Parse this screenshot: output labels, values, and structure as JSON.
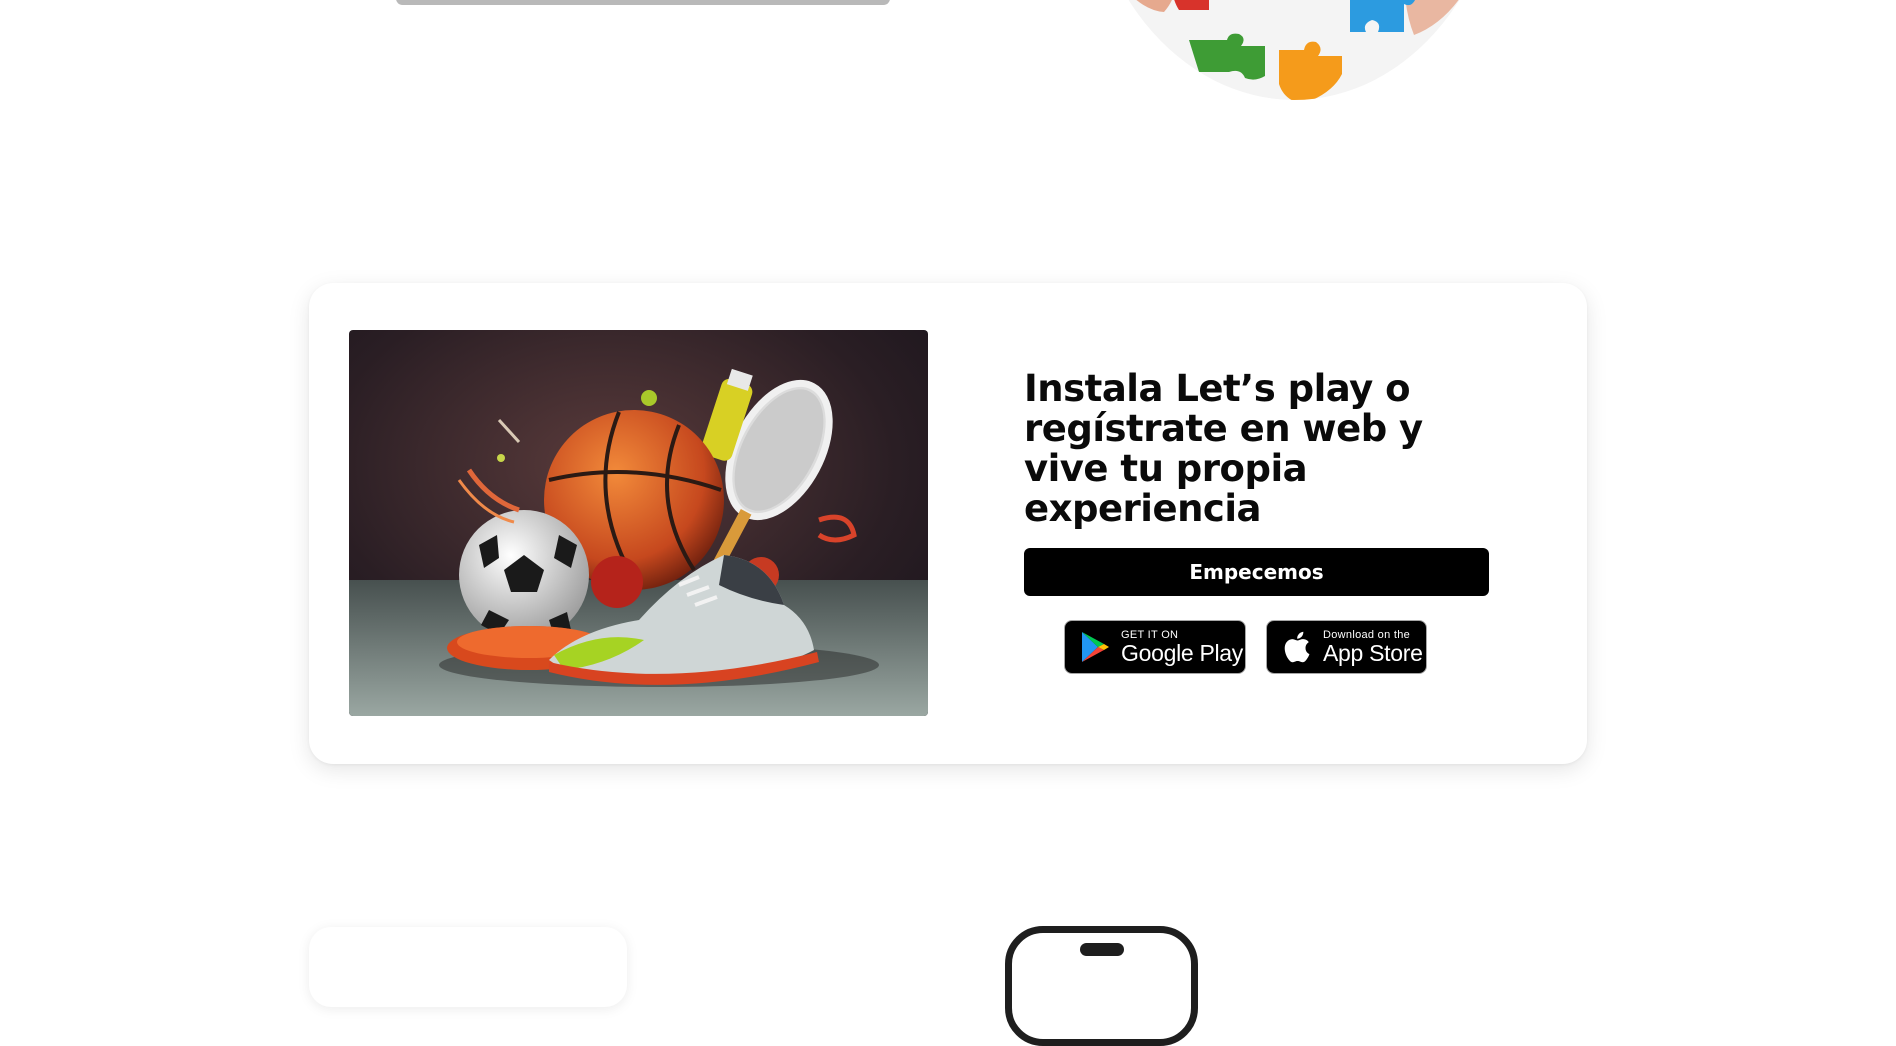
{
  "install_section": {
    "headline": "Instala Let’s play o regístrate en web y vive tu propia experiencia",
    "cta_label": "Empecemos",
    "google_play": {
      "small": "GET IT ON",
      "big": "Google Play",
      "icon": "google-play-icon"
    },
    "app_store": {
      "small": "Download on the",
      "big": "App Store",
      "icon": "apple-icon"
    },
    "hero_image": "sports-equipment-image"
  },
  "colors": {
    "primary": "#000000",
    "background": "#ffffff",
    "text": "#0a0a0a"
  }
}
